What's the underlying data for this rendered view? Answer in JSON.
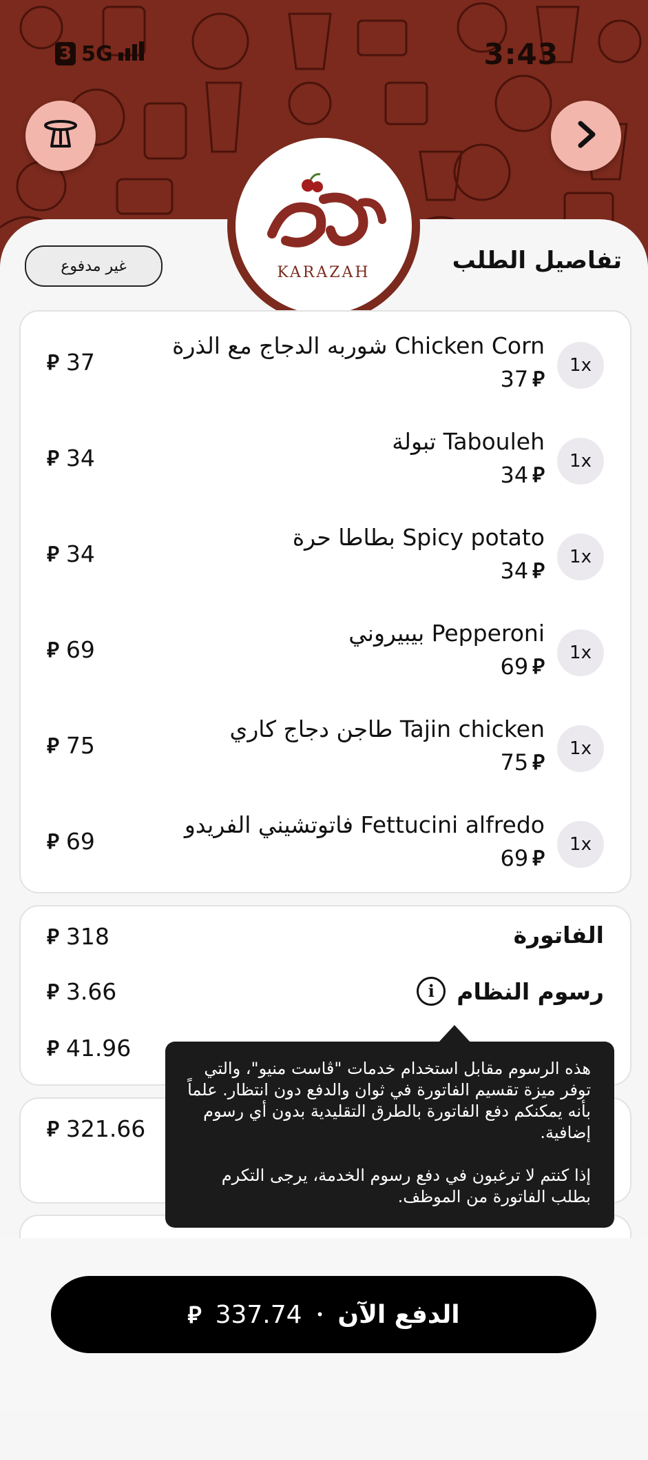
{
  "status_bar": {
    "signal": "5G",
    "badge": "3",
    "time": "3:43"
  },
  "header": {
    "logo_text": "KARAZAH",
    "back_icon": "chevron-right-icon",
    "table_icon": "table-icon"
  },
  "order": {
    "title": "تفاصيل الطلب",
    "status_badge": "غير مدفوع",
    "currency_symbol": "⃁",
    "items": [
      {
        "qty": "1x",
        "name": "شوربه الدجاج مع الذرة Chicken Corn",
        "price": "37",
        "total": "37"
      },
      {
        "qty": "1x",
        "name": "تبولة Tabouleh",
        "price": "34",
        "total": "34"
      },
      {
        "qty": "1x",
        "name": "بطاطا حرة Spicy potato",
        "price": "34",
        "total": "34"
      },
      {
        "qty": "1x",
        "name": "بيبيروني Pepperoni",
        "price": "69",
        "total": "69"
      },
      {
        "qty": "1x",
        "name": "طاجن دجاج كاري  Tajin chicken",
        "price": "75",
        "total": "75"
      },
      {
        "qty": "1x",
        "name": "فاتوتشيني الفريدو Fettucini alfredo",
        "price": "69",
        "total": "69"
      }
    ]
  },
  "bill": {
    "invoice_label": "الفاتورة",
    "invoice_value": "318",
    "system_fee_label": "رسوم النظام",
    "system_fee_value": "3.66",
    "vat_value": "41.96",
    "total_value": "321.66"
  },
  "tooltip": {
    "paragraph1": "هذه الرسوم مقابل استخدام خدمات \"ڤاست منيو\"، والتي توفر ميزة تقسيم الفاتورة في ثوان والدفع دون انتظار. علماً بأنه يمكنكم دفع الفاتورة بالطرق التقليدية بدون أي رسوم إضافية.",
    "paragraph2": "إذا كنتم لا ترغبون في  دفع رسوم الخدمة، يرجى التكرم بطلب الفاتورة من الموظف."
  },
  "pay_button": {
    "label": "الدفع الآن",
    "amount": "337.74",
    "separator": "•"
  }
}
